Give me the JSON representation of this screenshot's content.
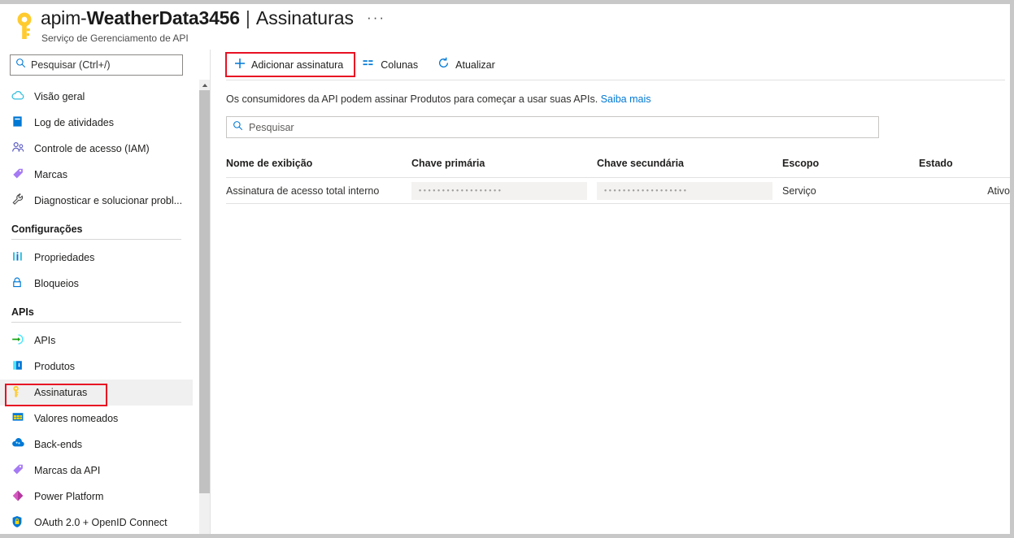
{
  "header": {
    "icon": "key-icon",
    "resource_name_prefix": "apim-",
    "resource_name_bold": "WeatherData3456",
    "separator": "|",
    "page_name": "Assinaturas",
    "ellipsis": "···",
    "subtitle": "Serviço de Gerenciamento de API"
  },
  "sidebar": {
    "search": {
      "placeholder": "Pesquisar (Ctrl+/)",
      "value": "",
      "icon": "search-icon"
    },
    "collapse_label": "«",
    "items": [
      {
        "label": "Visão geral",
        "icon": "cloud-icon",
        "selected": false
      },
      {
        "label": "Log de atividades",
        "icon": "activity-log-icon",
        "selected": false
      },
      {
        "label": "Controle de acesso (IAM)",
        "icon": "access-control-icon",
        "selected": false
      },
      {
        "label": "Marcas",
        "icon": "tag-icon",
        "selected": false
      },
      {
        "label": "Diagnosticar e solucionar probl...",
        "icon": "wrench-icon",
        "selected": false
      }
    ],
    "groups": [
      {
        "title": "Configurações",
        "items": [
          {
            "label": "Propriedades",
            "icon": "properties-icon",
            "selected": false
          },
          {
            "label": "Bloqueios",
            "icon": "lock-icon",
            "selected": false
          }
        ]
      },
      {
        "title": "APIs",
        "items": [
          {
            "label": "APIs",
            "icon": "apis-icon",
            "selected": false
          },
          {
            "label": "Produtos",
            "icon": "products-icon",
            "selected": false
          },
          {
            "label": "Assinaturas",
            "icon": "key-icon",
            "selected": true
          },
          {
            "label": "Valores nomeados",
            "icon": "named-values-icon",
            "selected": false
          },
          {
            "label": "Back-ends",
            "icon": "backend-cloud-icon",
            "selected": false
          },
          {
            "label": "Marcas da API",
            "icon": "tag-icon",
            "selected": false
          },
          {
            "label": "Power Platform",
            "icon": "power-platform-icon",
            "selected": false
          },
          {
            "label": "OAuth 2.0 + OpenID Connect",
            "icon": "shield-lock-icon",
            "selected": false
          }
        ]
      }
    ]
  },
  "toolbar": {
    "add_label": "Adicionar assinatura",
    "add_icon": "plus-icon",
    "columns_label": "Colunas",
    "columns_icon": "columns-icon",
    "refresh_label": "Atualizar",
    "refresh_icon": "refresh-icon"
  },
  "content": {
    "description_text": "Os consumidores da API podem assinar Produtos para começar a usar suas APIs.",
    "description_link": "Saiba mais",
    "filter": {
      "placeholder": "Pesquisar",
      "value": "",
      "icon": "search-icon"
    }
  },
  "table": {
    "columns": [
      "Nome de exibição",
      "Chave primária",
      "Chave secundária",
      "Escopo",
      "Estado"
    ],
    "rows": [
      {
        "name": "Assinatura de acesso total interno",
        "primary_key": "••••••••••••••••••",
        "secondary_key": "••••••••••••••••••",
        "scope": "Serviço",
        "state": "Ativo"
      }
    ]
  },
  "highlights": {
    "accent_red": "#e81123",
    "accent_blue": "#0078d4",
    "selected_bg": "#f0f0f0"
  }
}
